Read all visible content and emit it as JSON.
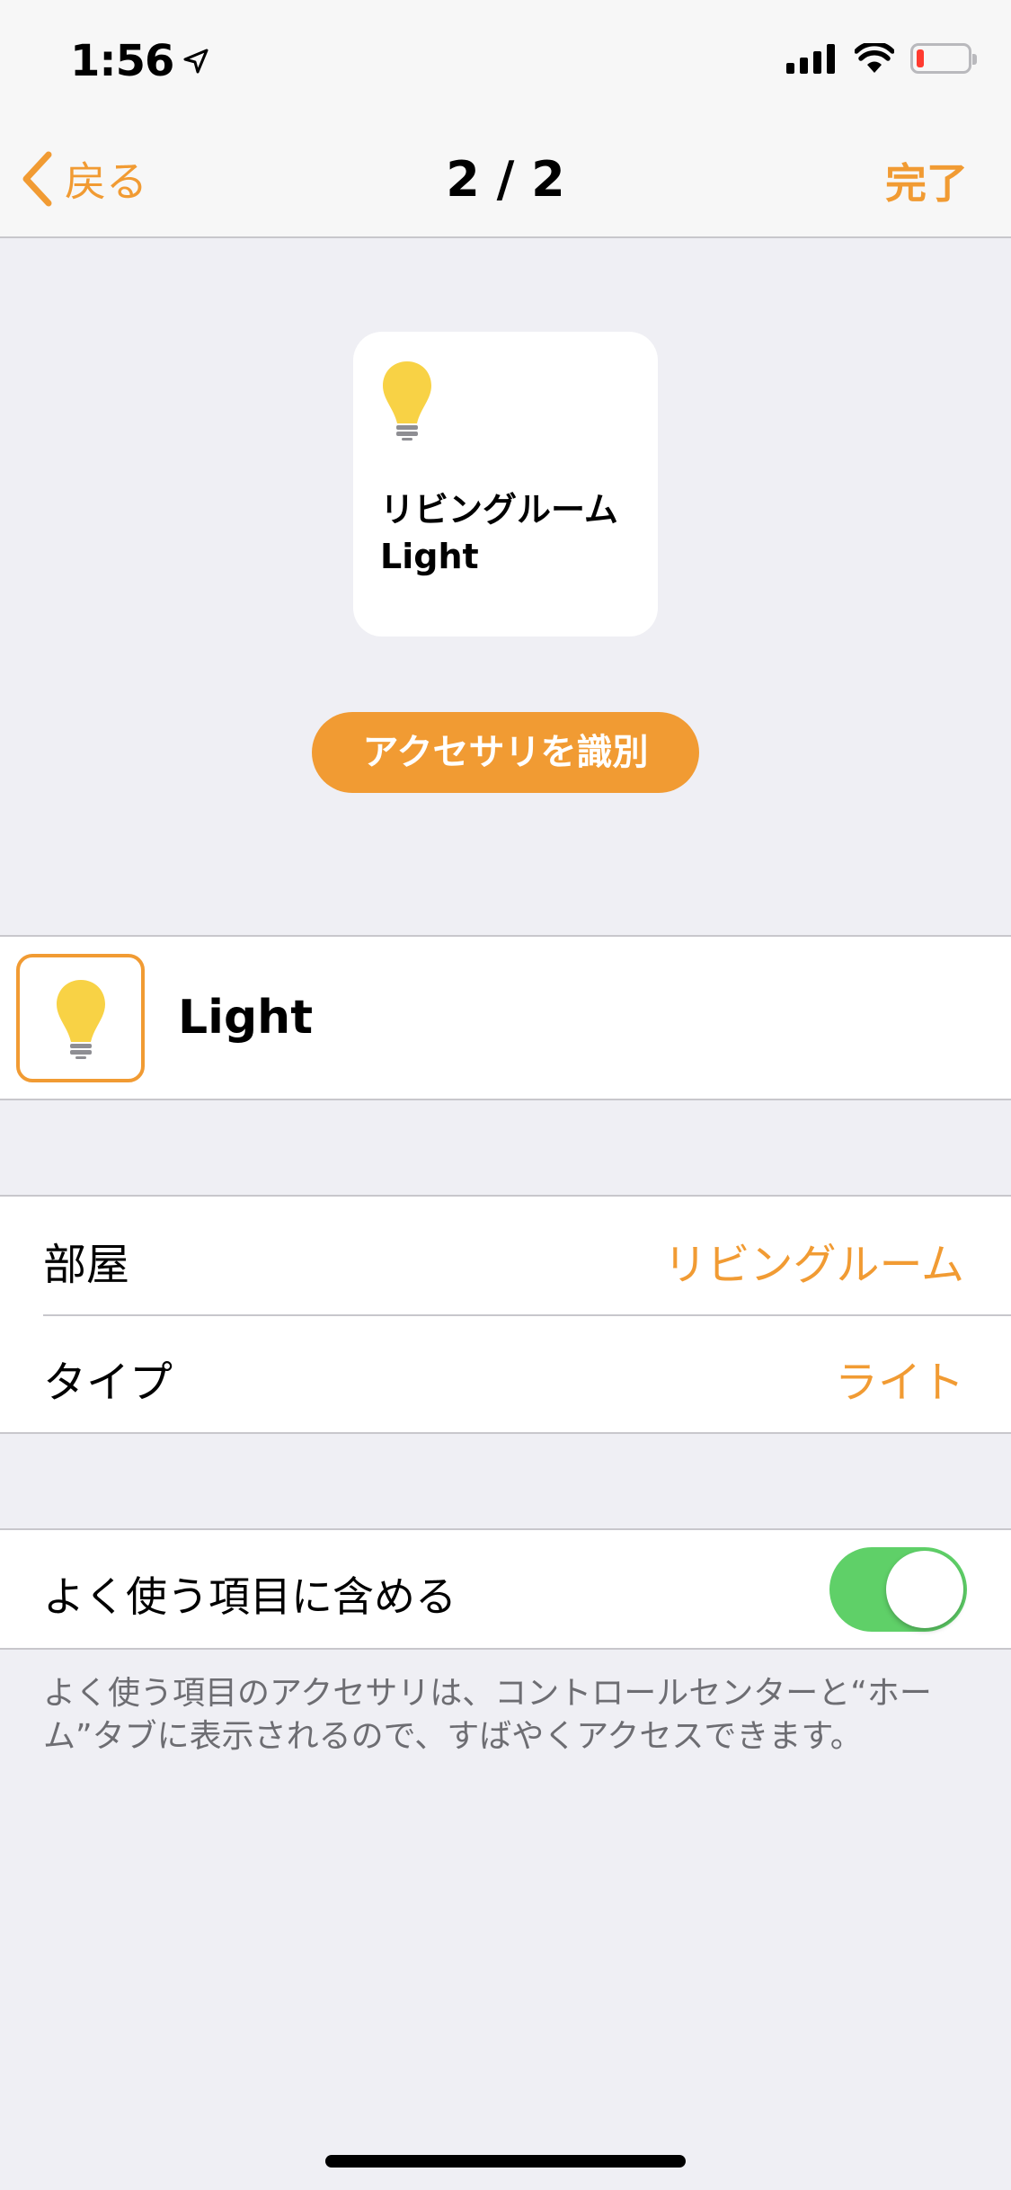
{
  "status_bar": {
    "time": "1:56"
  },
  "nav": {
    "back_label": "戻る",
    "title": "2 / 2",
    "done_label": "完了"
  },
  "tile": {
    "name": "リビングルーム Light"
  },
  "identify_button_label": "アクセサリを識別",
  "accessory_name": "Light",
  "settings": {
    "room_label": "部屋",
    "room_value": "リビングルーム",
    "type_label": "タイプ",
    "type_value": "ライト"
  },
  "favorite": {
    "label": "よく使う項目に含める",
    "enabled": true,
    "footnote": "よく使う項目のアクセサリは、コントロールセンターと“ホーム”タブに表示されるので、すばやくアクセスできます。"
  },
  "colors": {
    "accent": "#f19b33",
    "bulb": "#f8d245",
    "toggle_on": "#5fd068"
  },
  "icons": [
    "location-arrow-icon",
    "cellular-signal-icon",
    "wifi-icon",
    "battery-icon",
    "chevron-left-icon",
    "lightbulb-icon"
  ]
}
